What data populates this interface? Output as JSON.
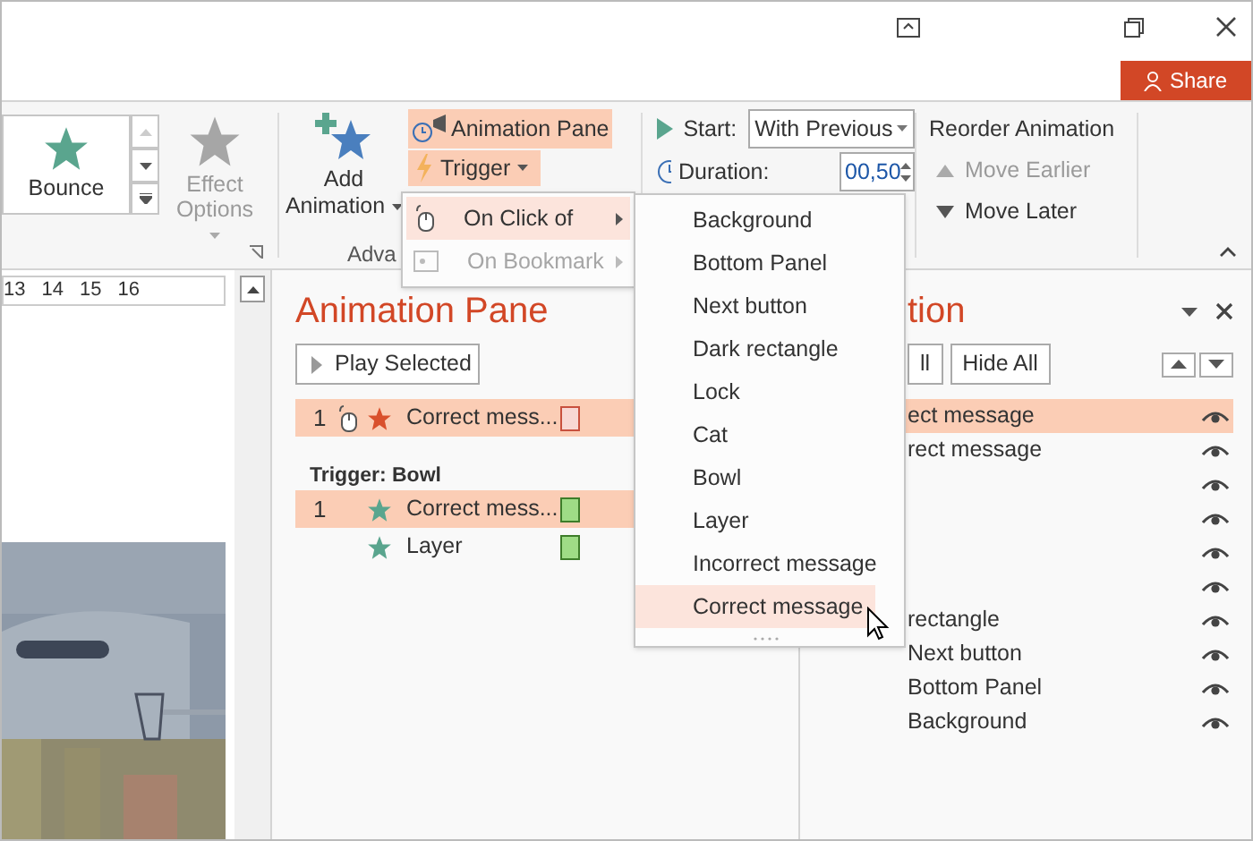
{
  "share_button": "Share",
  "ribbon": {
    "gallery_effect": "Bounce",
    "effect_options": {
      "label": "Effect Options",
      "disabled": true
    },
    "add_animation": "Add Animation",
    "group_label": "Adva",
    "animation_pane_button": {
      "label": "Animation Pane",
      "selected": true
    },
    "trigger_button": {
      "label": "Trigger",
      "expanded": true
    },
    "start": {
      "label": "Start:",
      "value": "With Previous"
    },
    "duration": {
      "label": "Duration:",
      "value": "00,50"
    },
    "reorder": {
      "title": "Reorder Animation",
      "buttons": [
        {
          "label": "Move Earlier",
          "kind": "up",
          "disabled": true
        },
        {
          "label": "Move Later",
          "kind": "down",
          "disabled": false
        }
      ]
    }
  },
  "ruler": [
    "13",
    "14",
    "15",
    "16"
  ],
  "animation_pane": {
    "title": "Animation Pane",
    "play_button": "Play Selected",
    "entries": [
      {
        "number": "1",
        "on_click": true,
        "kind": "exit",
        "label": "Correct mess...",
        "selected": true
      }
    ],
    "trigger_group": {
      "heading": "Trigger: Bowl",
      "entries": [
        {
          "number": "1",
          "on_click": false,
          "kind": "entrance",
          "label": "Correct mess...",
          "selected": true
        },
        {
          "on_click": false,
          "kind": "entrance",
          "label": "Layer",
          "selected": false
        }
      ]
    }
  },
  "selection_pane": {
    "title": "tion",
    "buttons": [
      "ll",
      "Hide All"
    ],
    "items": [
      {
        "label": "ect message",
        "selected": true
      },
      {
        "label": "rect message",
        "selected": false
      },
      {
        "selected": false
      },
      {
        "selected": false
      },
      {
        "selected": false
      },
      {
        "selected": false
      },
      {
        "label": "rectangle",
        "selected": false
      },
      {
        "label": "Next button",
        "selected": false
      },
      {
        "label": "Bottom Panel",
        "selected": false
      },
      {
        "label": "Background",
        "selected": false
      }
    ]
  },
  "trigger_menu": [
    {
      "label": "On Click of",
      "selected": true,
      "disabled": false
    },
    {
      "label": "On Bookmark",
      "selected": false,
      "disabled": true
    }
  ],
  "objects_menu": [
    {
      "label": "Background",
      "selected": false
    },
    {
      "label": "Bottom Panel",
      "selected": false
    },
    {
      "label": "Next button",
      "selected": false
    },
    {
      "label": "Dark rectangle",
      "selected": false
    },
    {
      "label": "Lock",
      "selected": false
    },
    {
      "label": "Cat",
      "selected": false
    },
    {
      "label": "Bowl",
      "selected": false
    },
    {
      "label": "Layer",
      "selected": false
    },
    {
      "label": "Incorrect message",
      "selected": false
    },
    {
      "label": "Correct message",
      "selected": true
    }
  ]
}
